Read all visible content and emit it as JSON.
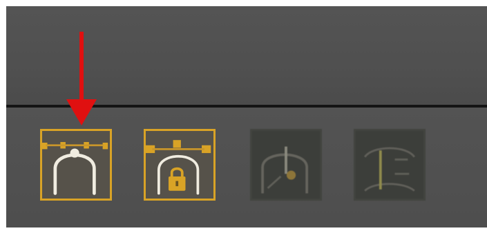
{
  "toolbar": {
    "buttons": [
      {
        "icon": "bezier-curve-edit-icon",
        "state": "active"
      },
      {
        "icon": "bezier-curve-lock-icon",
        "state": "active"
      },
      {
        "icon": "pivot-adjust-icon",
        "state": "inactive"
      },
      {
        "icon": "vertical-align-icon",
        "state": "inactive"
      }
    ]
  },
  "colors": {
    "panel_background": "#505050",
    "divider": "#141414",
    "active_accent": "#d9a326",
    "annotation_arrow": "#e01010",
    "icon_stroke": "#f0ece0"
  },
  "annotation": {
    "type": "arrow-down",
    "target": "bezier-curve-edit-icon"
  }
}
